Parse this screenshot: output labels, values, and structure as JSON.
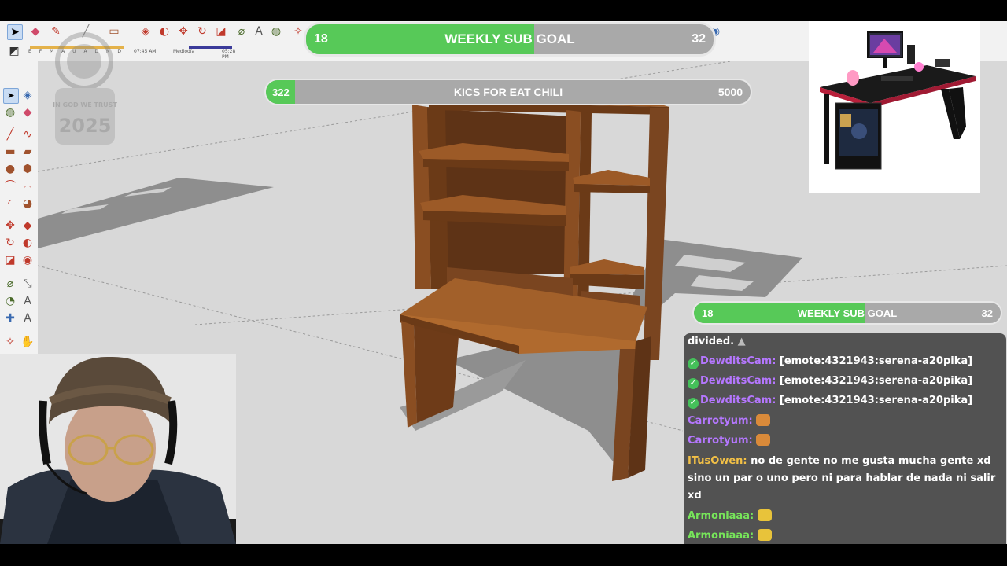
{
  "goals": {
    "weekly_top": {
      "current": "18",
      "label": "WEEKLY SUB GOAL",
      "target": "32",
      "progress": 0.56
    },
    "kicks": {
      "current": "322",
      "label": "KICS FOR EAT CHILI",
      "target": "5000",
      "progress": 0.06
    },
    "weekly_right": {
      "current": "18",
      "label": "WEEKLY SUB GOAL",
      "target": "32",
      "progress": 0.56
    }
  },
  "toolbar": {
    "slider_letters": "E F M A U A D N D",
    "time_left": "07:45 AM",
    "midday": "Mediodía",
    "time_right": "05:28 PM"
  },
  "watermark": {
    "motto": "IN GOD WE TRUST",
    "year": "2025"
  },
  "chat": {
    "messages": [
      {
        "user": "",
        "text": "divided.",
        "user_color": "#ffffff",
        "verified": false,
        "emote": "none"
      },
      {
        "user": "DewditsCam:",
        "text": "[emote:4321943:serena-a20pika]",
        "user_color": "#b577ff",
        "verified": true,
        "emote": "none"
      },
      {
        "user": "DewditsCam:",
        "text": "[emote:4321943:serena-a20pika]",
        "user_color": "#b577ff",
        "verified": true,
        "emote": "none"
      },
      {
        "user": "DewditsCam:",
        "text": "[emote:4321943:serena-a20pika]",
        "user_color": "#b577ff",
        "verified": true,
        "emote": "none"
      },
      {
        "user": "Carrotyum:",
        "text": "",
        "user_color": "#b577ff",
        "verified": false,
        "emote": "orange"
      },
      {
        "user": "Carrotyum:",
        "text": "",
        "user_color": "#b577ff",
        "verified": false,
        "emote": "orange"
      },
      {
        "user": "ITusOwen:",
        "text": "no de gente no me gusta mucha gente xd sino un par o uno pero ni para hablar de nada ni salir xd",
        "user_color": "#f2c046",
        "verified": false,
        "emote": "none"
      },
      {
        "user": "Armoniaaa:",
        "text": "",
        "user_color": "#77e55a",
        "verified": false,
        "emote": "yellow"
      },
      {
        "user": "Armoniaaa:",
        "text": "",
        "user_color": "#77e55a",
        "verified": false,
        "emote": "yellow"
      }
    ]
  },
  "colors": {
    "goal_green": "#57c958",
    "goal_grey": "#a9a9a9",
    "wood": "#8a4e22",
    "viewport_bg": "#d8d8d8"
  }
}
